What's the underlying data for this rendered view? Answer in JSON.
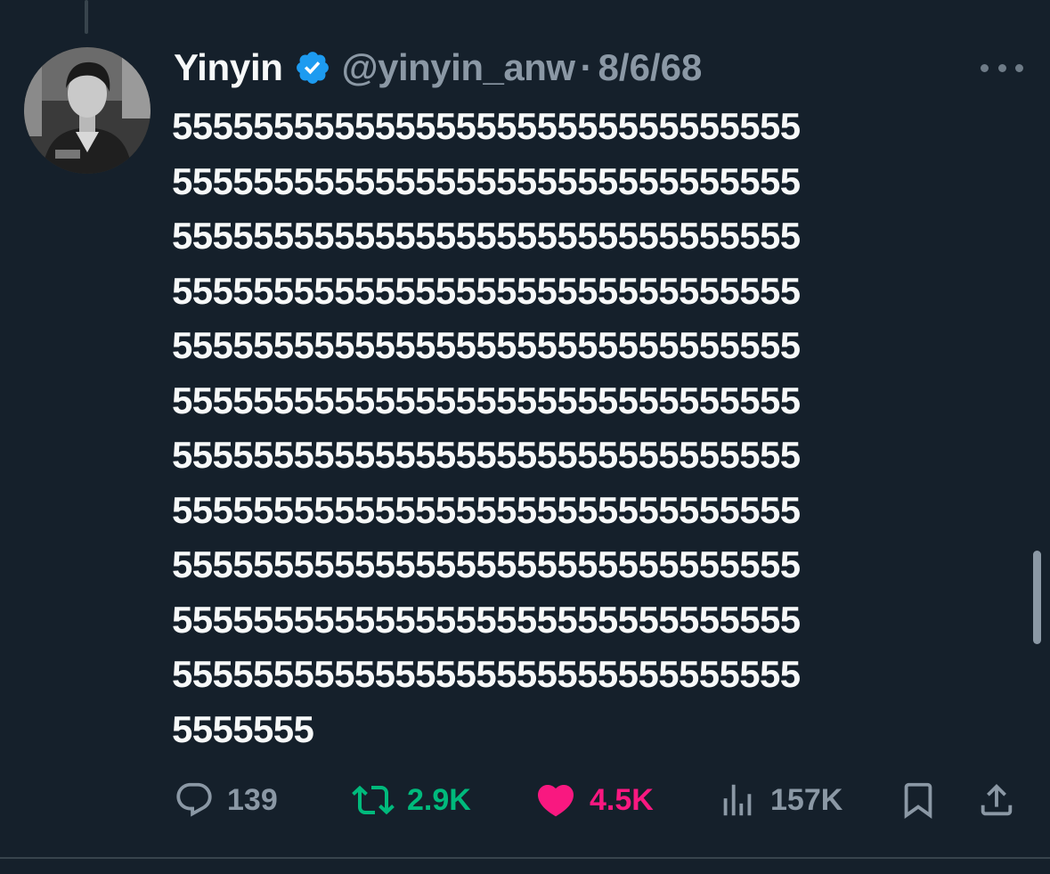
{
  "tweet": {
    "author": {
      "name": "Yinyin",
      "verified": true,
      "handle": "@yinyin_anw",
      "avatar_icon": "profile-photo"
    },
    "separator": "·",
    "date": "8/6/68",
    "lines": [
      "5555555555555555555555555555555",
      "5555555555555555555555555555555",
      "5555555555555555555555555555555",
      "5555555555555555555555555555555",
      "5555555555555555555555555555555",
      "5555555555555555555555555555555",
      "5555555555555555555555555555555",
      "5555555555555555555555555555555",
      "5555555555555555555555555555555",
      "5555555555555555555555555555555",
      "5555555555555555555555555555555",
      "5555555"
    ],
    "stats": {
      "replies": "139",
      "reposts": "2.9K",
      "likes": "4.5K",
      "views": "157K"
    }
  },
  "colors": {
    "background": "#15202b",
    "text": "#f7f9f9",
    "muted": "#8b98a5",
    "verified": "#1d9bf0",
    "repost": "#00ba7c",
    "like": "#f91880"
  },
  "icons": {
    "reply": "reply-bubble-icon",
    "repost": "repost-arrows-icon",
    "like": "heart-filled-icon",
    "views": "bar-chart-icon",
    "bookmark": "bookmark-icon",
    "share": "share-upload-icon",
    "more": "more-dots-icon",
    "verified": "verified-badge-icon"
  }
}
